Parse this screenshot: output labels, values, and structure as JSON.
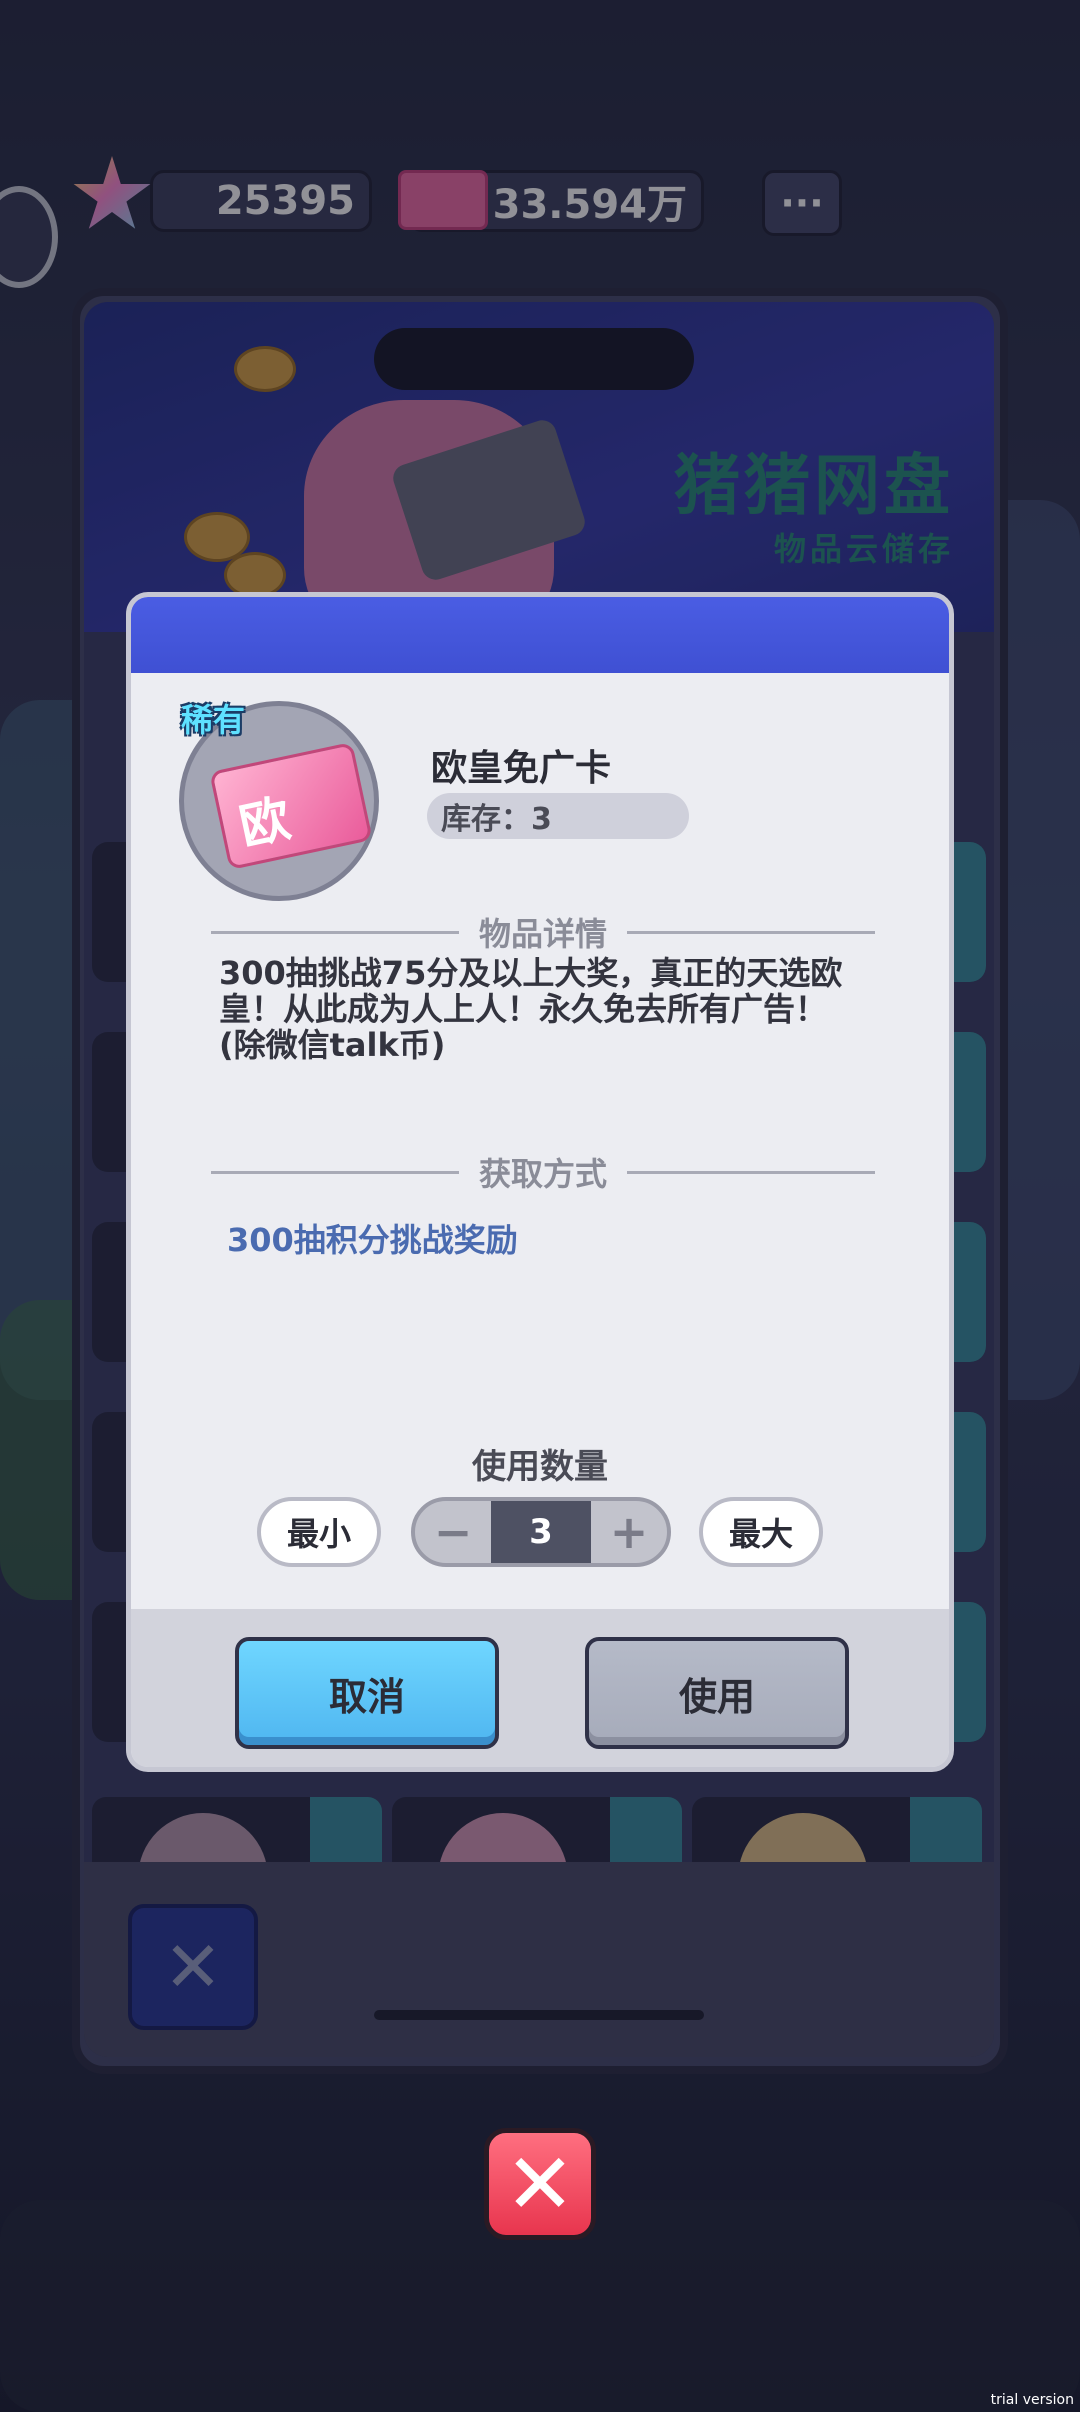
{
  "top_bar": {
    "star_icon": "star-icon",
    "star_count": "25395",
    "ticket_icon": "ticket-icon",
    "ticket_count": "33.594万",
    "more_label": "···"
  },
  "banner": {
    "title": "猪猪网盘",
    "subtitle": "物品云储存"
  },
  "modal": {
    "rarity": "稀有",
    "item_glyph": "欧",
    "item_name": "欧皇免广卡",
    "stock": "库存：3",
    "detail_title": "物品详情",
    "description": "300抽挑战75分及以上大奖，真正的天选欧皇！从此成为人上人！永久免去所有广告！(除微信talk币)",
    "obtain_title": "获取方式",
    "obtain_method": "300抽积分挑战奖励",
    "quantity_label": "使用数量",
    "min_label": "最小",
    "max_label": "最大",
    "minus_label": "−",
    "plus_label": "+",
    "quantity_value": "3",
    "cancel_label": "取消",
    "use_label": "使用"
  },
  "close_label": "✕",
  "back_label": "✕",
  "watermark": "trial version",
  "colors": {
    "header_blue": "#4a5de3",
    "cancel_blue": "#5fc6f8",
    "close_red": "#f04e62",
    "teal_title": "#2a8e7c"
  }
}
